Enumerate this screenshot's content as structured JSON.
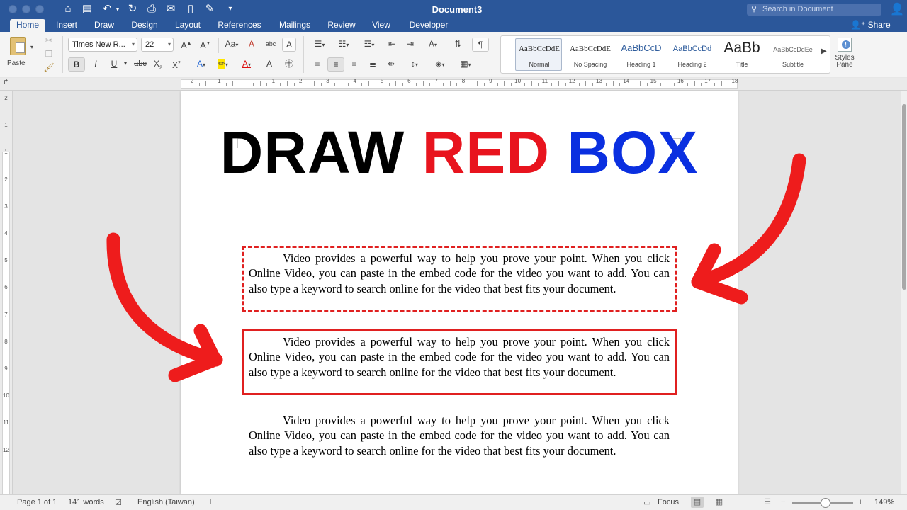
{
  "window": {
    "title": "Document3",
    "search_placeholder": "Search in Document"
  },
  "quick_access": {
    "home": "⌂",
    "save": "▤",
    "undo": "↶",
    "redo": "↻",
    "print": "⎙",
    "more": "▾"
  },
  "tabs": [
    "Home",
    "Insert",
    "Draw",
    "Design",
    "Layout",
    "References",
    "Mailings",
    "Review",
    "View",
    "Developer"
  ],
  "share_label": "Share",
  "ribbon": {
    "paste_label": "Paste",
    "font_name": "Times New R...",
    "font_size": "22",
    "grow": "A",
    "shrink": "A",
    "case": "Aa",
    "clear": "A",
    "bold": "B",
    "italic": "I",
    "underline": "U",
    "strike": "abc",
    "subscript": "X",
    "superscript": "X",
    "text_effects": "A",
    "highlight": "✏",
    "font_color": "A",
    "charborder": "A",
    "phonetic": "abc",
    "pilcrow": "¶",
    "styles": [
      {
        "preview": "AaBbCcDdE",
        "label": "Normal"
      },
      {
        "preview": "AaBbCcDdE",
        "label": "No Spacing"
      },
      {
        "preview": "AaBbCcD",
        "label": "Heading 1"
      },
      {
        "preview": "AaBbCcDd",
        "label": "Heading 2"
      },
      {
        "preview": "AaBb",
        "label": "Title"
      },
      {
        "preview": "AaBbCcDdEe",
        "label": "Subtitle"
      }
    ],
    "styles_pane_label": "Styles Pane"
  },
  "ruler": {
    "h_numbers": [
      "2",
      "1",
      "",
      "1",
      "2",
      "3",
      "4",
      "5",
      "6",
      "7",
      "8",
      "9",
      "10",
      "11",
      "12",
      "13",
      "14",
      "15",
      "16",
      "17",
      "18"
    ],
    "v_numbers": [
      "2",
      "1",
      "1",
      "2",
      "3",
      "4",
      "5",
      "6",
      "7",
      "8",
      "9",
      "10",
      "11",
      "12"
    ]
  },
  "document": {
    "headline": {
      "word1": "DRAW",
      "word2": "RED",
      "word3": "BOX"
    },
    "headline_colors": {
      "word1": "#000000",
      "word2": "#e8141e",
      "word3": "#0a2fe0"
    },
    "paragraph": "Video provides a powerful way to help you prove your point. When you click Online Video, you can paste in the embed code for the video you want to add. You can also type a keyword to search online for the video that best fits your document.",
    "box_color": "#e02020",
    "arrow_color": "#ee1c1c"
  },
  "status": {
    "page": "Page 1 of 1",
    "words": "141 words",
    "language": "English (Taiwan)",
    "focus": "Focus",
    "zoom_minus": "−",
    "zoom_plus": "+",
    "zoom": "149%"
  }
}
